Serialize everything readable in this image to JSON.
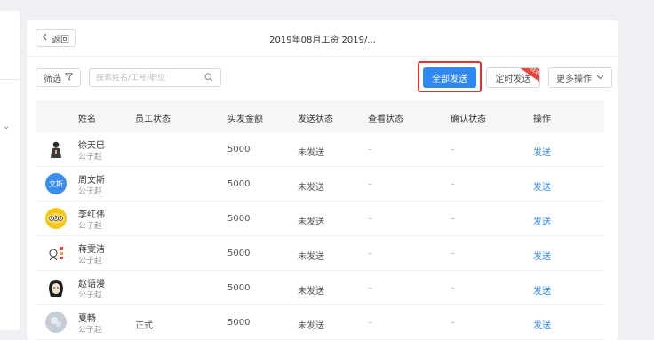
{
  "nav": {
    "back_label": "返回",
    "page_title": "2019年08月工资 2019/..."
  },
  "toolbar": {
    "filter_label": "筛选",
    "search_placeholder": "搜索姓名/工号/职位",
    "send_all_label": "全部发送",
    "timed_send_label": "定时发送",
    "timed_send_badge": "NEW",
    "more_label": "更多操作"
  },
  "colors": {
    "primary": "#2e88f0",
    "highlight": "#e0332e",
    "header_bg": "#f5f6f8"
  },
  "table": {
    "columns": [
      "姓名",
      "员工状态",
      "实发金额",
      "发送状态",
      "查看状态",
      "确认状态",
      "操作"
    ],
    "rows": [
      {
        "name": "徐天巳",
        "company": "公子赵",
        "status": "",
        "amount": "5000",
        "send": "未发送",
        "view": "–",
        "confirm": "–",
        "action": "发送",
        "avatar_icon": "person-photo-icon",
        "avatar_text": ""
      },
      {
        "name": "周文斯",
        "company": "公子赵",
        "status": "",
        "amount": "5000",
        "send": "未发送",
        "view": "–",
        "confirm": "–",
        "action": "发送",
        "avatar_icon": "initials-avatar",
        "avatar_text": "文斯"
      },
      {
        "name": "李红伟",
        "company": "公子赵",
        "status": "",
        "amount": "5000",
        "send": "未发送",
        "view": "–",
        "confirm": "–",
        "action": "发送",
        "avatar_icon": "yellow-cartoon-icon",
        "avatar_text": ""
      },
      {
        "name": "蒋雯洁",
        "company": "公子赵",
        "status": "",
        "amount": "5000",
        "send": "未发送",
        "view": "–",
        "confirm": "–",
        "action": "发送",
        "avatar_icon": "sketch-avatar-icon",
        "avatar_text": ""
      },
      {
        "name": "赵语漫",
        "company": "公子赵",
        "status": "",
        "amount": "5000",
        "send": "未发送",
        "view": "–",
        "confirm": "–",
        "action": "发送",
        "avatar_icon": "girl-cartoon-icon",
        "avatar_text": ""
      },
      {
        "name": "夏畅",
        "company": "公子赵",
        "status": "正式",
        "amount": "5000",
        "send": "未发送",
        "view": "–",
        "confirm": "–",
        "action": "发送",
        "avatar_icon": "flower-photo-icon",
        "avatar_text": ""
      }
    ]
  }
}
